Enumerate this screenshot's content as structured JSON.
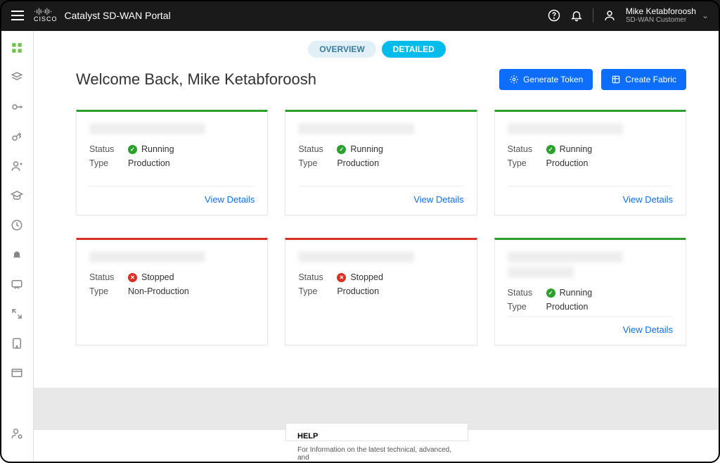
{
  "header": {
    "portal_title": "Catalyst SD-WAN Portal",
    "user_name": "Mike Ketabforoosh",
    "user_role": "SD-WAN Customer"
  },
  "tabs": {
    "overview": "OVERVIEW",
    "detailed": "DETAILED"
  },
  "page": {
    "welcome": "Welcome Back, Mike Ketabforoosh",
    "btn_generate_token": "Generate Token",
    "btn_create_fabric": "Create Fabric"
  },
  "labels": {
    "status": "Status",
    "type": "Type",
    "view_details": "View Details",
    "running": "Running",
    "stopped": "Stopped",
    "production": "Production",
    "non_production": "Non-Production"
  },
  "cards": [
    {
      "status": "Running",
      "status_ok": true,
      "type": "Production",
      "border": "green",
      "show_link": true
    },
    {
      "status": "Running",
      "status_ok": true,
      "type": "Production",
      "border": "green",
      "show_link": true
    },
    {
      "status": "Running",
      "status_ok": true,
      "type": "Production",
      "border": "green",
      "show_link": true
    },
    {
      "status": "Stopped",
      "status_ok": false,
      "type": "Non-Production",
      "border": "red",
      "show_link": false
    },
    {
      "status": "Stopped",
      "status_ok": false,
      "type": "Production",
      "border": "red",
      "show_link": false
    },
    {
      "status": "Running",
      "status_ok": true,
      "type": "Production",
      "border": "green",
      "show_link": true
    }
  ],
  "help": {
    "title": "HELP",
    "body": "For Information on the latest technical, advanced, and"
  }
}
